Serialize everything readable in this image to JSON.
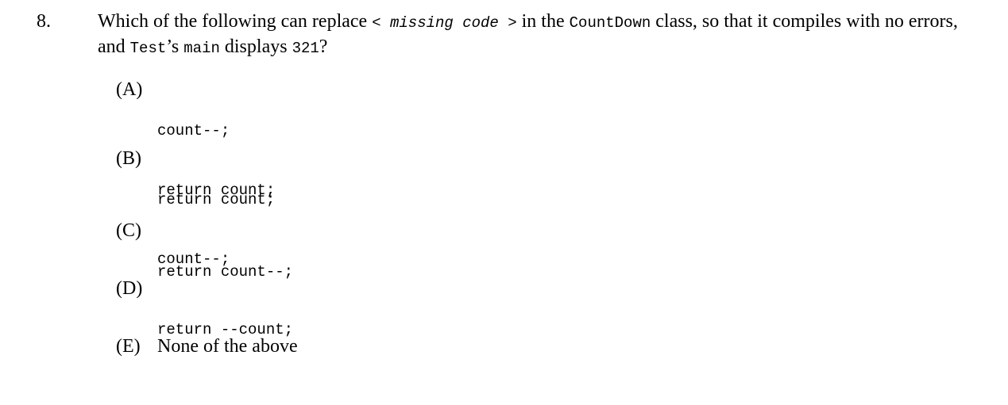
{
  "question": {
    "number": "8.",
    "text_1": "Which of the following can replace ",
    "missing_open": "<",
    "missing_text": " missing code ",
    "missing_close": ">",
    "text_2": " in the ",
    "class_name": "CountDown",
    "text_3": " class, so that it compiles with no errors, and ",
    "test_name": "Test",
    "text_4": "’s ",
    "main_name": "main",
    "text_5": " displays ",
    "output_value": "321",
    "text_6": "?"
  },
  "choices": [
    {
      "letter": "(A)",
      "lines": [
        "count--;",
        "return count;"
      ]
    },
    {
      "letter": "(B)",
      "lines": [
        "return count;",
        "count--;"
      ]
    },
    {
      "letter": "(C)",
      "lines": [
        "return count--;"
      ]
    },
    {
      "letter": "(D)",
      "lines": [
        "return --count;"
      ]
    },
    {
      "letter": "(E)",
      "text": "None of the above"
    }
  ]
}
